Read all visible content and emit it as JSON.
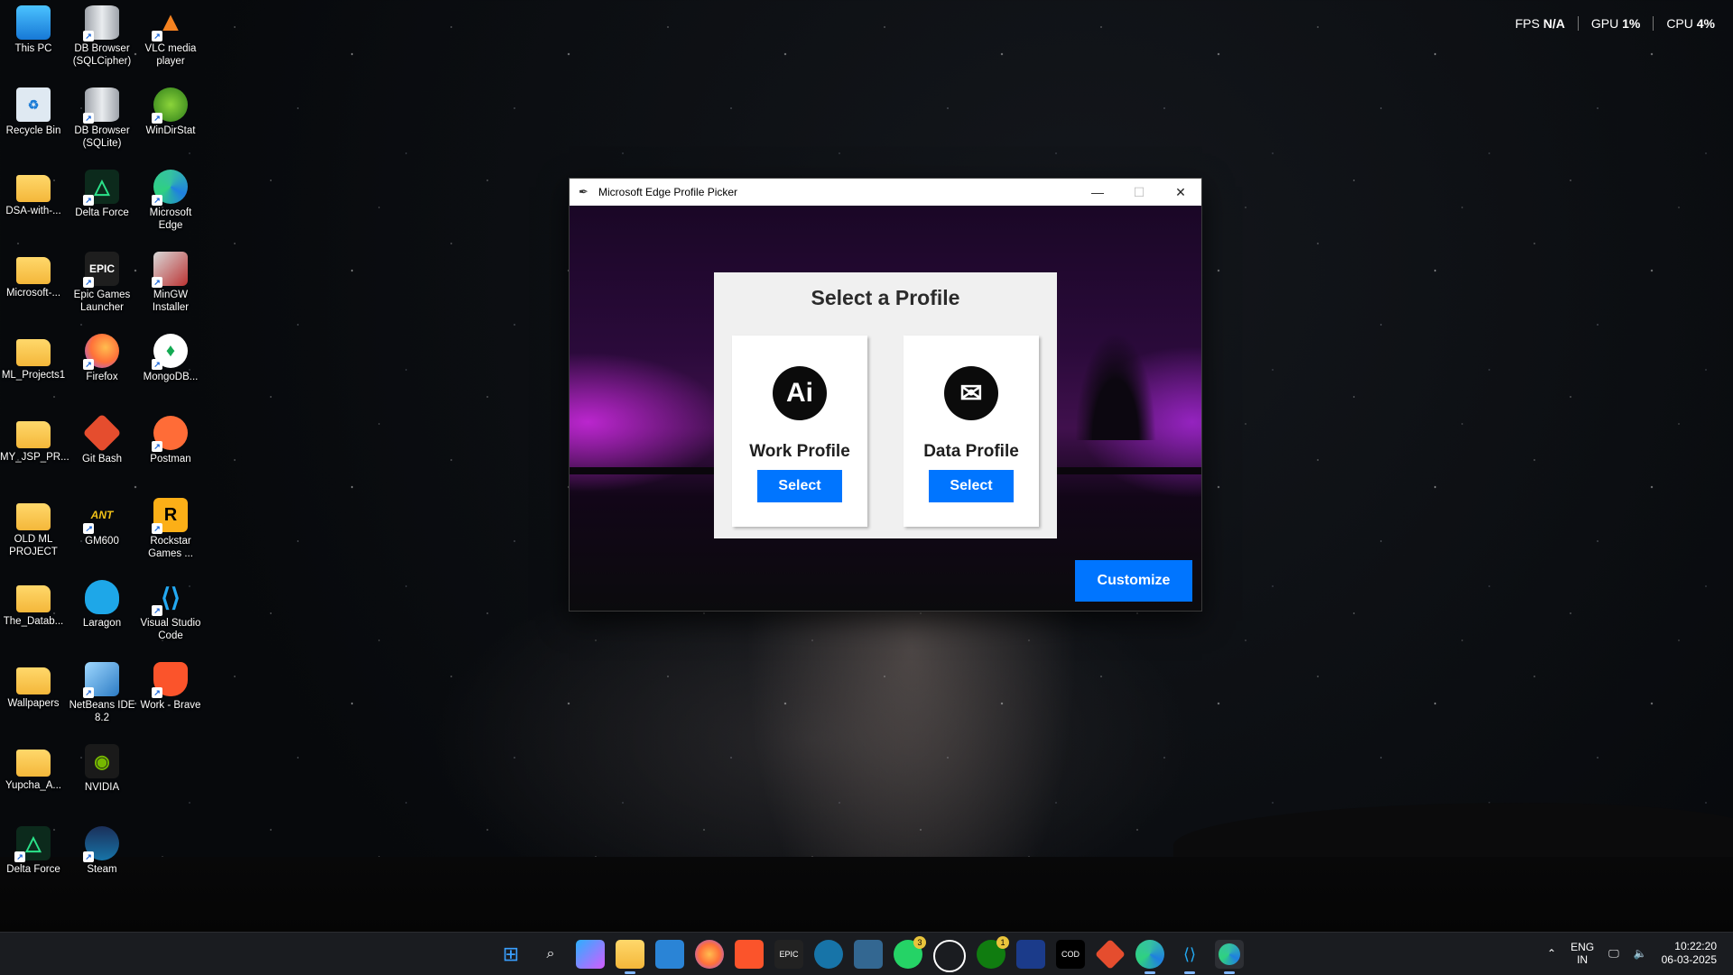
{
  "perf": {
    "fps_label": "FPS",
    "fps_value": "N/A",
    "gpu_label": "GPU",
    "gpu_value": "1%",
    "cpu_label": "CPU",
    "cpu_value": "4%"
  },
  "desktop_icons": [
    {
      "label": "This PC",
      "icon": "monitor-icon"
    },
    {
      "label": "DB Browser (SQLCipher)",
      "icon": "database-icon"
    },
    {
      "label": "VLC media player",
      "icon": "vlc-cone-icon"
    },
    {
      "label": "Recycle Bin",
      "icon": "recycle-bin-icon"
    },
    {
      "label": "DB Browser (SQLite)",
      "icon": "database-icon"
    },
    {
      "label": "WinDirStat",
      "icon": "windirstat-icon"
    },
    {
      "label": "DSA-with-...",
      "icon": "folder-icon"
    },
    {
      "label": "Delta Force",
      "icon": "delta-force-icon"
    },
    {
      "label": "Microsoft Edge",
      "icon": "edge-icon"
    },
    {
      "label": "Microsoft-...",
      "icon": "folder-icon"
    },
    {
      "label": "Epic Games Launcher",
      "icon": "epic-games-icon"
    },
    {
      "label": "MinGW Installer",
      "icon": "mingw-icon"
    },
    {
      "label": "ML_Projects1",
      "icon": "folder-icon"
    },
    {
      "label": "Firefox",
      "icon": "firefox-icon"
    },
    {
      "label": "MongoDB...",
      "icon": "mongodb-icon"
    },
    {
      "label": "MY_JSP_PR...",
      "icon": "folder-icon"
    },
    {
      "label": "Git Bash",
      "icon": "git-icon"
    },
    {
      "label": "Postman",
      "icon": "postman-icon"
    },
    {
      "label": "OLD ML PROJECT",
      "icon": "folder-icon"
    },
    {
      "label": "GM600",
      "icon": "gm600-icon"
    },
    {
      "label": "Rockstar Games ...",
      "icon": "rockstar-icon"
    },
    {
      "label": "The_Datab...",
      "icon": "folder-icon"
    },
    {
      "label": "Laragon",
      "icon": "laragon-icon"
    },
    {
      "label": "Visual Studio Code",
      "icon": "vscode-icon"
    },
    {
      "label": "Wallpapers",
      "icon": "folder-icon"
    },
    {
      "label": "NetBeans IDE 8.2",
      "icon": "netbeans-icon"
    },
    {
      "label": "Work - Brave",
      "icon": "brave-icon"
    },
    {
      "label": "Yupcha_A...",
      "icon": "folder-icon"
    },
    {
      "label": "NVIDIA",
      "icon": "nvidia-icon"
    },
    {
      "label": "Delta Force",
      "icon": "delta-force-icon"
    },
    {
      "label": "Steam",
      "icon": "steam-icon"
    }
  ],
  "window": {
    "title": "Microsoft Edge Profile Picker",
    "heading": "Select a Profile",
    "profiles": [
      {
        "name": "Work Profile",
        "icon_text": "Ai",
        "button": "Select"
      },
      {
        "name": "Data Profile",
        "icon_text": "✉",
        "button": "Select"
      }
    ],
    "customize_label": "Customize"
  },
  "taskbar": {
    "icons": [
      "start-icon",
      "search-icon",
      "copilot-icon",
      "file-explorer-icon",
      "store-icon",
      "firefox-icon",
      "brave-icon",
      "epic-games-icon",
      "steam-icon",
      "postgres-icon",
      "whatsapp-icon",
      "chatgpt-icon",
      "xbox-icon",
      "app-icon",
      "callofduty-icon",
      "git-icon",
      "edge-icon",
      "vscode-icon",
      "edge-dev-icon"
    ],
    "whatsapp_badge": "3",
    "xbox_badge": "1",
    "lang_top": "ENG",
    "lang_bottom": "IN",
    "time": "10:22:20",
    "date": "06-03-2025"
  }
}
